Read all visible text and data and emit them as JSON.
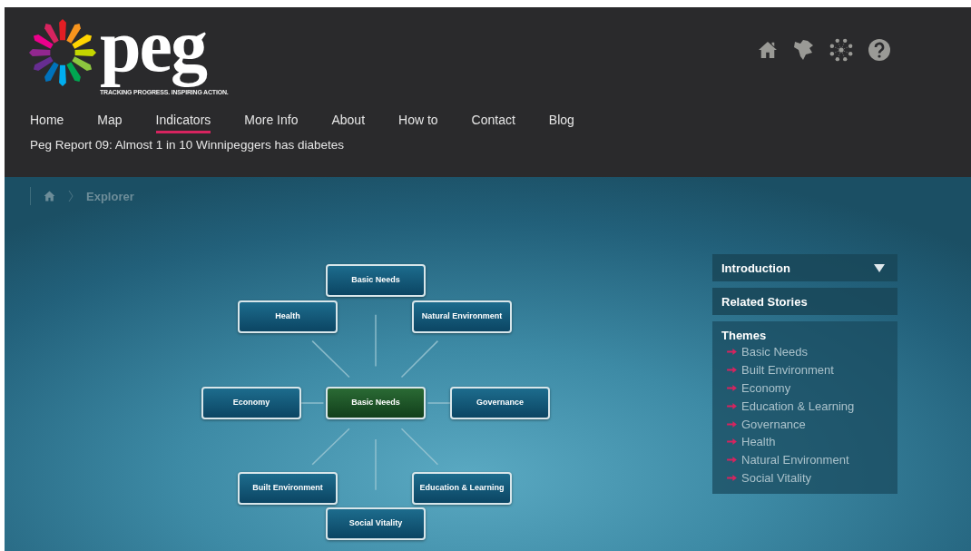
{
  "logo": {
    "wordmark": "peg",
    "tagline": "TRACKING PROGRESS. INSPIRING ACTION."
  },
  "nav": [
    {
      "label": "Home",
      "selected": false
    },
    {
      "label": "Map",
      "selected": false
    },
    {
      "label": "Indicators",
      "selected": true
    },
    {
      "label": "More Info",
      "selected": false
    },
    {
      "label": "About",
      "selected": false
    },
    {
      "label": "How to",
      "selected": false
    },
    {
      "label": "Contact",
      "selected": false
    },
    {
      "label": "Blog",
      "selected": false
    }
  ],
  "headline": "Peg Report 09: Almost 1 in 10 Winnipeggers has diabetes",
  "breadcrumb": {
    "current": "Explorer"
  },
  "diagram": {
    "nodes": [
      {
        "label": "Basic Needs",
        "selected": false
      },
      {
        "label": "Health",
        "selected": false
      },
      {
        "label": "Natural Environment",
        "selected": false
      },
      {
        "label": "Economy",
        "selected": false
      },
      {
        "label": "Basic Needs",
        "selected": true
      },
      {
        "label": "Governance",
        "selected": false
      },
      {
        "label": "Built Environment",
        "selected": false
      },
      {
        "label": "Education & Learning",
        "selected": false
      },
      {
        "label": "Social Vitality",
        "selected": false
      }
    ]
  },
  "panel": {
    "sections": [
      {
        "label": "Introduction",
        "kind": "dropdown"
      },
      {
        "label": "Related Stories",
        "kind": "plain"
      }
    ],
    "themes": {
      "title": "Themes",
      "items": [
        "Basic Needs",
        "Built Environment",
        "Economy",
        "Education & Learning",
        "Governance",
        "Health",
        "Natural Environment",
        "Social Vitality"
      ]
    }
  }
}
